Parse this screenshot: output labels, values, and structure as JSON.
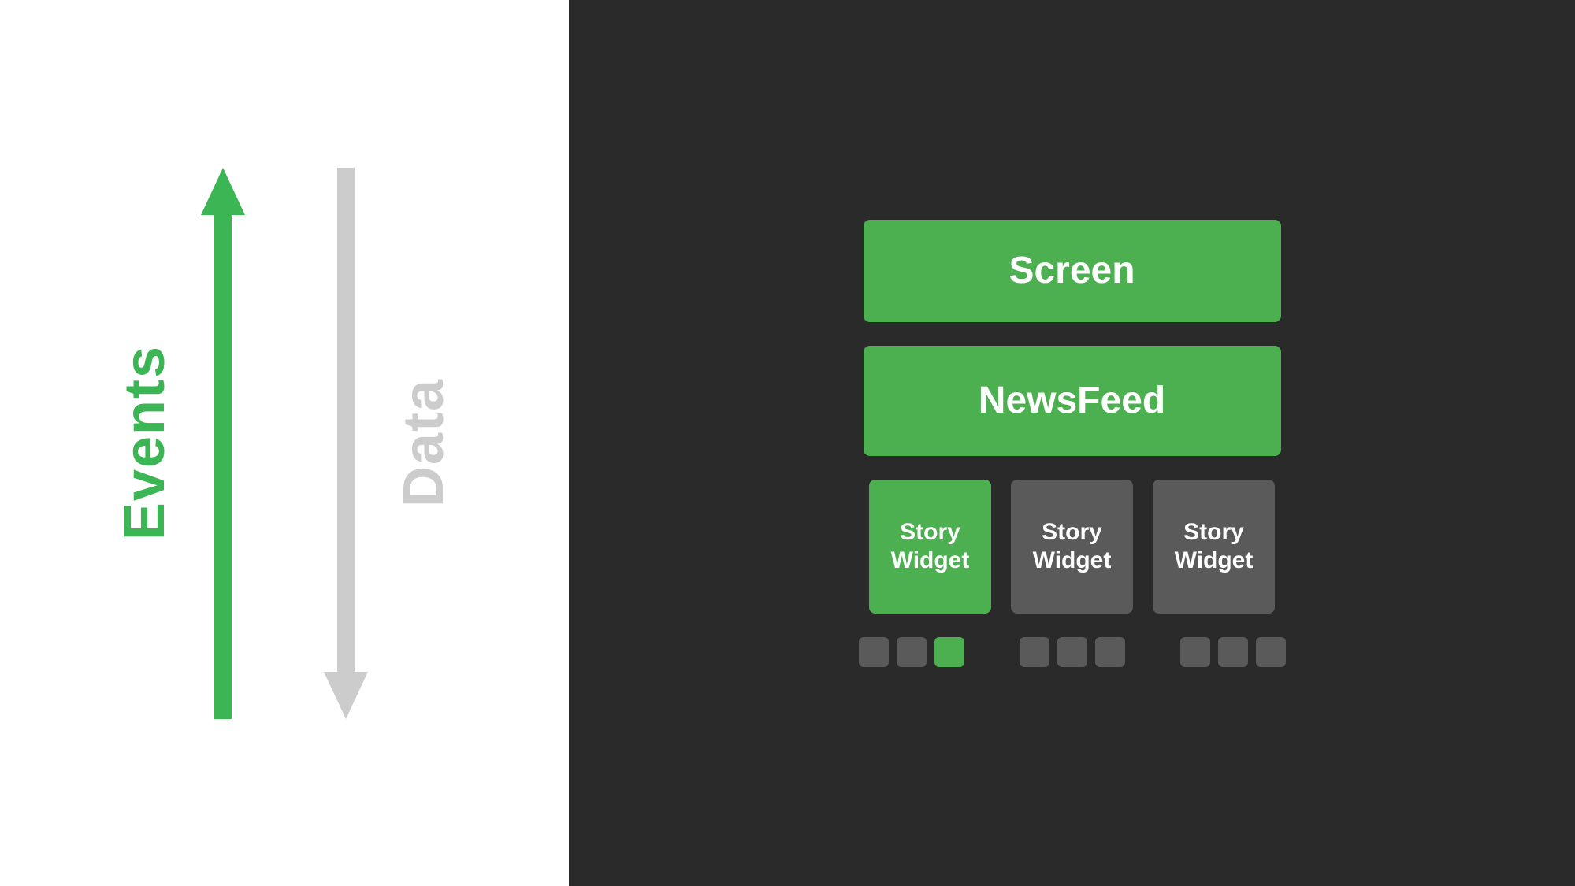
{
  "left": {
    "events_label": "Events",
    "data_label": "Data"
  },
  "right": {
    "screen_label": "Screen",
    "newsfeed_label": "NewsFeed",
    "story_widget_labels": [
      "Story\nWidget",
      "Story\nWidget",
      "Story\nWidget"
    ],
    "colors": {
      "green": "#4caf50",
      "gray_dark": "#5a5a5a",
      "background": "#2a2a2a"
    },
    "dot_groups": [
      {
        "dots": [
          "gray",
          "gray",
          "green"
        ]
      },
      {
        "dots": [
          "gray",
          "gray",
          "gray"
        ]
      },
      {
        "dots": [
          "gray",
          "gray",
          "gray"
        ]
      }
    ]
  }
}
